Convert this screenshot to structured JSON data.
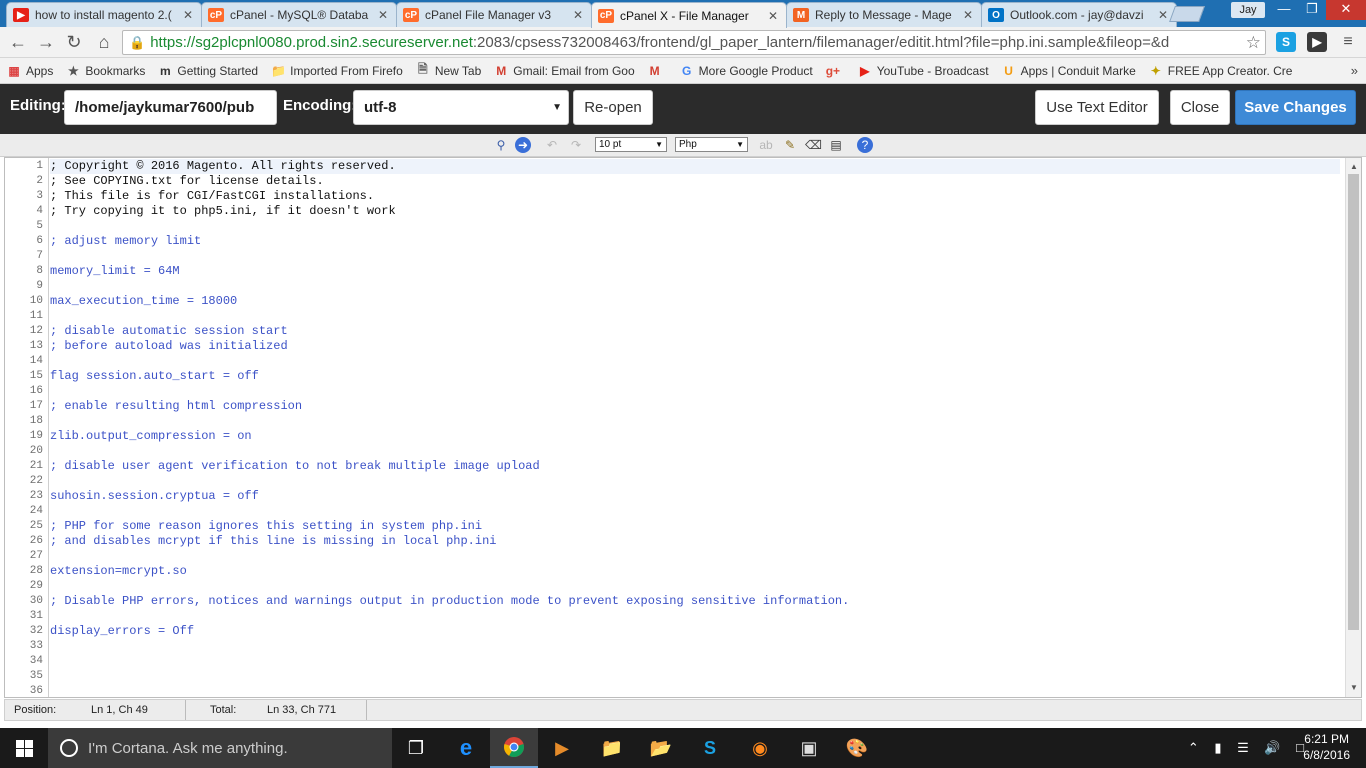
{
  "browser": {
    "tabs": [
      {
        "label": "how to install magento 2.(",
        "icon": "youtube-icon",
        "color": "#e62117"
      },
      {
        "label": "cPanel - MySQL® Databa",
        "icon": "cpanel-icon",
        "color": "#ff6c2c"
      },
      {
        "label": "cPanel File Manager v3",
        "icon": "cpanel-icon",
        "color": "#ff6c2c"
      },
      {
        "label": "cPanel X - File Manager",
        "icon": "cpanel-icon",
        "color": "#ff6c2c",
        "active": true
      },
      {
        "label": "Reply to Message - Mage",
        "icon": "magento-icon",
        "color": "#f26322"
      },
      {
        "label": "Outlook.com - jay@davzi",
        "icon": "outlook-icon",
        "color": "#0072c6"
      }
    ],
    "profile_name": "Jay",
    "url_secure": "https://sg2plcpnl0080.prod.sin2.secureserver.net",
    "url_rest": ":2083/cpsess732008463/frontend/gl_paper_lantern/filemanager/editit.html?file=php.ini.sample&fileop=&d",
    "bookmarks": [
      {
        "label": "Apps",
        "icon": "apps-grid-icon"
      },
      {
        "label": "Bookmarks",
        "icon": "star-icon"
      },
      {
        "label": "Getting Started",
        "icon": "m-icon"
      },
      {
        "label": "Imported From Firefo",
        "icon": "folder-icon"
      },
      {
        "label": "New Tab",
        "icon": "page-icon"
      },
      {
        "label": "Gmail: Email from Goo",
        "icon": "gmail-icon"
      },
      {
        "label": "",
        "icon": "gmail-icon"
      },
      {
        "label": "More Google Product",
        "icon": "google-icon"
      },
      {
        "label": "",
        "icon": "google-plus-icon"
      },
      {
        "label": "YouTube - Broadcast",
        "icon": "youtube-icon"
      },
      {
        "label": "Apps | Conduit Marke",
        "icon": "conduit-icon"
      },
      {
        "label": "FREE App Creator. Cre",
        "icon": "app-creator-icon"
      }
    ]
  },
  "editor_header": {
    "editing_label": "Editing:",
    "path": "/home/jaykumar7600/pub",
    "encoding_label": "Encoding:",
    "encoding_value": "utf-8",
    "reopen_label": "Re-open",
    "text_editor_label": "Use Text Editor",
    "close_label": "Close",
    "save_label": "Save Changes"
  },
  "editor_toolbar": {
    "font_size": "10 pt",
    "syntax": "Php"
  },
  "code_lines": [
    "; Copyright © 2016 Magento. All rights reserved.",
    "; See COPYING.txt for license details.",
    "; This file is for CGI/FastCGI installations.",
    "; Try copying it to php5.ini, if it doesn't work",
    "",
    "; adjust memory limit",
    "",
    "memory_limit = 64M",
    "",
    "max_execution_time = 18000",
    "",
    "; disable automatic session start",
    "; before autoload was initialized",
    "",
    "flag session.auto_start = off",
    "",
    "; enable resulting html compression",
    "",
    "zlib.output_compression = on",
    "",
    "; disable user agent verification to not break multiple image upload",
    "",
    "suhosin.session.cryptua = off",
    "",
    "; PHP for some reason ignores this setting in system php.ini",
    "; and disables mcrypt if this line is missing in local php.ini",
    "",
    "extension=mcrypt.so",
    "",
    "; Disable PHP errors, notices and warnings output in production mode to prevent exposing sensitive information.",
    "",
    "display_errors = Off",
    "",
    "",
    "",
    ""
  ],
  "status_bar": {
    "position_label": "Position:",
    "position_value": "Ln 1, Ch 49",
    "total_label": "Total:",
    "total_value": "Ln 33, Ch 771"
  },
  "taskbar": {
    "cortana_placeholder": "I'm Cortana. Ask me anything.",
    "time": "6:21 PM",
    "date": "6/8/2016"
  }
}
